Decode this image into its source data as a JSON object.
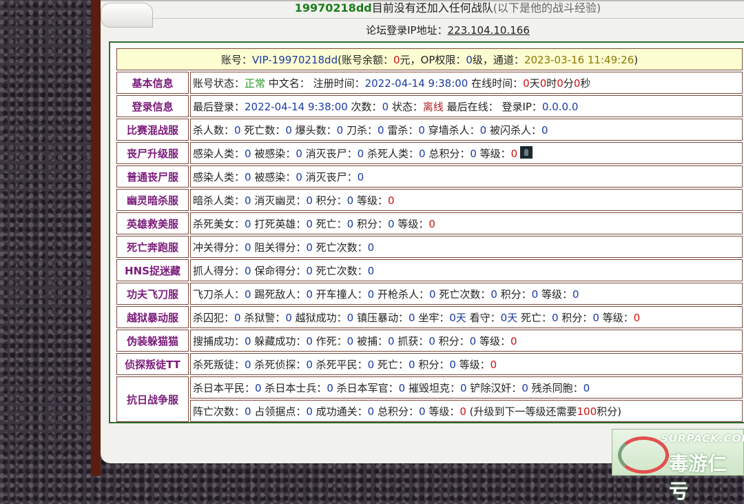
{
  "header": {
    "user_id": "19970218dd",
    "status_text": "目前没有还加入任何战队",
    "note": "(以下是他的战斗经验)",
    "ip_label": "论坛登录IP地址：",
    "ip_value": "223.104.10.166"
  },
  "account": {
    "p1": "账号：",
    "account": "VIP-19970218dd",
    "p2": "(账号余额：",
    "balance": "0",
    "p3": "元，OP权限：",
    "op": "0",
    "p4": "级，通道：",
    "datetime": "2023-03-16 11:49:26",
    "p5": ")"
  },
  "rows": [
    {
      "label": "基本信息",
      "cells": [
        {
          "t": "账号状态："
        },
        {
          "t": "正常",
          "c": "g"
        },
        {
          "t": " 中文名： 注册时间："
        },
        {
          "t": "2022-04-14 9:38:00",
          "c": "n"
        },
        {
          "t": " 在线时间："
        },
        {
          "t": "0",
          "c": "r"
        },
        {
          "t": "天"
        },
        {
          "t": "0",
          "c": "r"
        },
        {
          "t": "时"
        },
        {
          "t": "0",
          "c": "r"
        },
        {
          "t": "分"
        },
        {
          "t": "0",
          "c": "r"
        },
        {
          "t": "秒"
        }
      ]
    },
    {
      "label": "登录信息",
      "cells": [
        {
          "t": "最后登录："
        },
        {
          "t": "2022-04-14 9:38:00",
          "c": "n"
        },
        {
          "t": " 次数："
        },
        {
          "t": "0",
          "c": "n"
        },
        {
          "t": " 状态："
        },
        {
          "t": "离线",
          "c": "dk"
        },
        {
          "t": " 最后在线： 登录IP："
        },
        {
          "t": "0.0.0.0",
          "c": "n"
        }
      ]
    },
    {
      "label": "比赛混战服",
      "cells": [
        {
          "t": "杀人数："
        },
        {
          "t": "0",
          "c": "n"
        },
        {
          "t": " 死亡数："
        },
        {
          "t": "0",
          "c": "n"
        },
        {
          "t": " 爆头数："
        },
        {
          "t": "0",
          "c": "n"
        },
        {
          "t": " 刀杀："
        },
        {
          "t": "0",
          "c": "n"
        },
        {
          "t": " 雷杀："
        },
        {
          "t": "0",
          "c": "n"
        },
        {
          "t": " 穿墙杀人："
        },
        {
          "t": "0",
          "c": "n"
        },
        {
          "t": " 被闪杀人："
        },
        {
          "t": "0",
          "c": "n"
        }
      ]
    },
    {
      "label": "丧尸升级服",
      "avatar": true,
      "cells": [
        {
          "t": "感染人类："
        },
        {
          "t": "0",
          "c": "n"
        },
        {
          "t": " 被感染："
        },
        {
          "t": "0",
          "c": "n"
        },
        {
          "t": " 消灭丧尸："
        },
        {
          "t": "0",
          "c": "n"
        },
        {
          "t": " 杀死人类："
        },
        {
          "t": "0",
          "c": "n"
        },
        {
          "t": " 总积分："
        },
        {
          "t": "0",
          "c": "n"
        },
        {
          "t": " 等级："
        },
        {
          "t": "0",
          "c": "r"
        }
      ]
    },
    {
      "label": "普通丧尸服",
      "cells": [
        {
          "t": "感染人类："
        },
        {
          "t": "0",
          "c": "n"
        },
        {
          "t": " 被感染："
        },
        {
          "t": "0",
          "c": "n"
        },
        {
          "t": " 消灭丧尸："
        },
        {
          "t": "0",
          "c": "n"
        }
      ]
    },
    {
      "label": "幽灵暗杀服",
      "cells": [
        {
          "t": "暗杀人类："
        },
        {
          "t": "0",
          "c": "n"
        },
        {
          "t": " 消灭幽灵："
        },
        {
          "t": "0",
          "c": "n"
        },
        {
          "t": " 积分："
        },
        {
          "t": "0",
          "c": "n"
        },
        {
          "t": " 等级："
        },
        {
          "t": "0",
          "c": "r"
        }
      ]
    },
    {
      "label": "英雄救美服",
      "cells": [
        {
          "t": "杀死美女："
        },
        {
          "t": "0",
          "c": "n"
        },
        {
          "t": " 打死英雄："
        },
        {
          "t": "0",
          "c": "n"
        },
        {
          "t": " 死亡："
        },
        {
          "t": "0",
          "c": "n"
        },
        {
          "t": " 积分："
        },
        {
          "t": "0",
          "c": "n"
        },
        {
          "t": " 等级："
        },
        {
          "t": "0",
          "c": "r"
        }
      ]
    },
    {
      "label": "死亡奔跑服",
      "cells": [
        {
          "t": "冲关得分："
        },
        {
          "t": "0",
          "c": "n"
        },
        {
          "t": " 阻关得分："
        },
        {
          "t": "0",
          "c": "n"
        },
        {
          "t": " 死亡次数："
        },
        {
          "t": "0",
          "c": "n"
        }
      ]
    },
    {
      "label": "HNS捉迷藏",
      "cells": [
        {
          "t": "抓人得分："
        },
        {
          "t": "0",
          "c": "n"
        },
        {
          "t": " 保命得分："
        },
        {
          "t": "0",
          "c": "n"
        },
        {
          "t": " 死亡次数："
        },
        {
          "t": "0",
          "c": "n"
        }
      ]
    },
    {
      "label": "功夫飞刀服",
      "cells": [
        {
          "t": "飞刀杀人："
        },
        {
          "t": "0",
          "c": "n"
        },
        {
          "t": " 踢死敌人："
        },
        {
          "t": "0",
          "c": "n"
        },
        {
          "t": " 开车撞人："
        },
        {
          "t": "0",
          "c": "n"
        },
        {
          "t": " 开枪杀人："
        },
        {
          "t": "0",
          "c": "n"
        },
        {
          "t": " 死亡次数："
        },
        {
          "t": "0",
          "c": "n"
        },
        {
          "t": " 积分："
        },
        {
          "t": "0",
          "c": "n"
        },
        {
          "t": " 等级："
        },
        {
          "t": "0",
          "c": "n"
        }
      ]
    },
    {
      "label": "越狱暴动服",
      "cells": [
        {
          "t": "杀囚犯："
        },
        {
          "t": "0",
          "c": "n"
        },
        {
          "t": " 杀狱警："
        },
        {
          "t": "0",
          "c": "n"
        },
        {
          "t": " 越狱成功："
        },
        {
          "t": "0",
          "c": "n"
        },
        {
          "t": " 镇压暴动："
        },
        {
          "t": "0",
          "c": "n"
        },
        {
          "t": " 坐牢："
        },
        {
          "t": "0天",
          "c": "n"
        },
        {
          "t": " 看守："
        },
        {
          "t": "0天",
          "c": "n"
        },
        {
          "t": " 死亡："
        },
        {
          "t": "0",
          "c": "n"
        },
        {
          "t": " 积分："
        },
        {
          "t": "0",
          "c": "n"
        },
        {
          "t": " 等级："
        },
        {
          "t": "0",
          "c": "r"
        }
      ]
    },
    {
      "label": "伪装躲猫猫",
      "cells": [
        {
          "t": "搜捕成功："
        },
        {
          "t": "0",
          "c": "n"
        },
        {
          "t": " 躲藏成功："
        },
        {
          "t": "0",
          "c": "n"
        },
        {
          "t": " 作死："
        },
        {
          "t": "0",
          "c": "n"
        },
        {
          "t": " 被捕："
        },
        {
          "t": "0",
          "c": "n"
        },
        {
          "t": " 抓获："
        },
        {
          "t": "0",
          "c": "n"
        },
        {
          "t": " 积分："
        },
        {
          "t": "0",
          "c": "n"
        },
        {
          "t": " 等级："
        },
        {
          "t": "0",
          "c": "r"
        }
      ]
    },
    {
      "label": "侦探叛徒TT",
      "cells": [
        {
          "t": "杀死叛徒："
        },
        {
          "t": "0",
          "c": "n"
        },
        {
          "t": " 杀死侦探："
        },
        {
          "t": "0",
          "c": "n"
        },
        {
          "t": " 杀死平民："
        },
        {
          "t": "0",
          "c": "n"
        },
        {
          "t": " 死亡："
        },
        {
          "t": "0",
          "c": "n"
        },
        {
          "t": " 积分："
        },
        {
          "t": "0",
          "c": "n"
        },
        {
          "t": " 等级："
        },
        {
          "t": "0",
          "c": "r"
        }
      ]
    }
  ],
  "war": {
    "label": "抗日战争服",
    "line1": [
      {
        "t": "杀日本平民："
      },
      {
        "t": "0",
        "c": "n"
      },
      {
        "t": " 杀日本士兵："
      },
      {
        "t": "0",
        "c": "n"
      },
      {
        "t": " 杀日本军官："
      },
      {
        "t": "0",
        "c": "n"
      },
      {
        "t": " 摧毁坦克："
      },
      {
        "t": "0",
        "c": "n"
      },
      {
        "t": " 铲除汉奸："
      },
      {
        "t": "0",
        "c": "n"
      },
      {
        "t": " 残杀同胞："
      },
      {
        "t": "0",
        "c": "n"
      }
    ],
    "line2": [
      {
        "t": "阵亡次数："
      },
      {
        "t": "0",
        "c": "n"
      },
      {
        "t": " 占领据点："
      },
      {
        "t": "0",
        "c": "n"
      },
      {
        "t": " 成功通关："
      },
      {
        "t": "0",
        "c": "n"
      },
      {
        "t": " 总积分："
      },
      {
        "t": "0",
        "c": "n"
      },
      {
        "t": " 等级："
      },
      {
        "t": "0",
        "c": "r"
      },
      {
        "t": " (升级到下一等级还需要"
      },
      {
        "t": "100",
        "c": "r"
      },
      {
        "t": "积分)"
      }
    ]
  },
  "logo": {
    "text1": "SURPACK.COM",
    "text2": "毒游仁亏"
  }
}
